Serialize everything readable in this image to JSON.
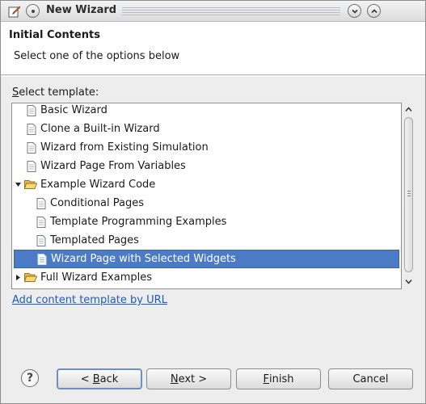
{
  "window": {
    "title": "New Wizard"
  },
  "header": {
    "title": "Initial Contents",
    "message": "Select one of the options below"
  },
  "template_label": {
    "mnemonic": "S",
    "rest": "elect template:"
  },
  "tree": {
    "items": [
      {
        "label": "Basic Wizard",
        "icon": "document-icon",
        "expanded": null,
        "selected": false
      },
      {
        "label": "Clone a Built-in Wizard",
        "icon": "document-icon",
        "expanded": null,
        "selected": false
      },
      {
        "label": "Wizard from Existing Simulation",
        "icon": "document-icon",
        "expanded": null,
        "selected": false
      },
      {
        "label": "Wizard Page From Variables",
        "icon": "document-icon",
        "expanded": null,
        "selected": false
      },
      {
        "label": "Example Wizard Code",
        "icon": "folder-open-icon",
        "expanded": true,
        "selected": false
      },
      {
        "label": "Conditional Pages",
        "icon": "document-icon",
        "expanded": null,
        "selected": false
      },
      {
        "label": "Template Programming Examples",
        "icon": "document-icon",
        "expanded": null,
        "selected": false
      },
      {
        "label": "Templated Pages",
        "icon": "document-icon",
        "expanded": null,
        "selected": false
      },
      {
        "label": "Wizard Page with Selected Widgets",
        "icon": "document-icon",
        "expanded": null,
        "selected": true
      },
      {
        "label": "Full Wizard Examples",
        "icon": "folder-open-icon",
        "expanded": false,
        "selected": false
      }
    ]
  },
  "link": {
    "add_template": "Add content template by URL"
  },
  "buttons": {
    "help": "?",
    "back_mnemonic": "B",
    "back_prefix": "< ",
    "back_rest": "ack",
    "next_mnemonic": "N",
    "next_rest": "ext >",
    "finish_mnemonic": "F",
    "finish_rest": "inish",
    "cancel": "Cancel"
  },
  "colors": {
    "selection": "#4c7bc6",
    "link": "#1c5cb8"
  }
}
